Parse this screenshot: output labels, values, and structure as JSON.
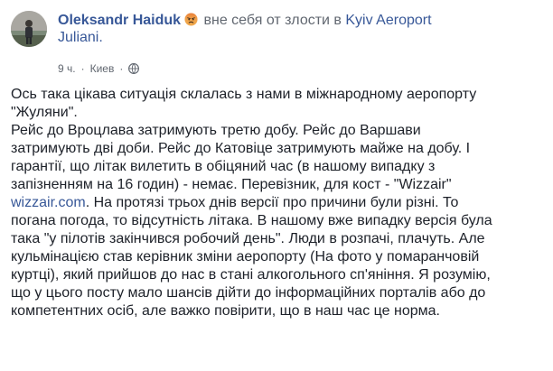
{
  "header": {
    "author": "Oleksandr Haiduk",
    "feeling": "вне себя от злости в",
    "place_line1": "Kyiv Aeroport",
    "place_line2": "Juliani.",
    "feeling_emoji": "angry-face-icon"
  },
  "meta": {
    "time": "9 ч.",
    "separator": "·",
    "location": "Киев",
    "separator2": "·",
    "privacy_icon": "globe-icon"
  },
  "post": {
    "lines": [
      "Ось така цікава ситуація склалась з нами в міжнародному аеропорту",
      "\"Жуляни\".",
      "Рейс до Вроцлава затримують третю добу. Рейс до Варшави",
      "затримують дві доби. Рейс до Катовіце затримують майже на добу. І",
      "гарантії, що літак вилетить в обіцяний час (в нашому випадку з",
      "запізненням на 16 годин) - немає. Перевізник, для кост - \"Wizzair\""
    ],
    "link_text": "wizzair.com",
    "link_line_rest": ". На протязі трьох днів версії про причини були різні. То",
    "lines_after": [
      "погана погода, то відсутність літака. В нашому вже випадку версія була",
      "така \"у пілотів закінчився робочий день\". Люди в розпачі, плачуть. Але",
      "кульмінацією став керівник зміни аеропорту (На фото у помаранчовій",
      "куртці), який прийшов до нас в стані алкогольного сп'яніння. Я розумію,",
      "що у цього посту мало шансів дійти до інформаційних порталів або до",
      "компетентних осіб, але важко повірити, що в наш час це норма."
    ]
  },
  "colors": {
    "link": "#385898",
    "text": "#1d2129",
    "meta": "#616770"
  }
}
